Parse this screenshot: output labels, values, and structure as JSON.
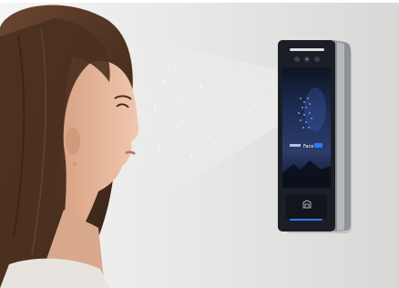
{
  "scene": {
    "device": {
      "brand_text": "",
      "screen_label": "Face",
      "icon": "contactless-card-icon"
    },
    "colors": {
      "wall": "#e3e4e2",
      "device_frame": "#1b1e24",
      "device_side": "#8e9197",
      "screen_top": "#1b2a4d",
      "screen_bottom": "#0e1322",
      "accent_blue": "#2a7bff",
      "hair": "#5a3a26",
      "skin": "#e8b89a"
    }
  }
}
